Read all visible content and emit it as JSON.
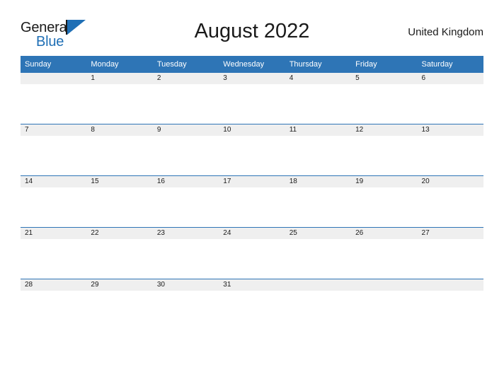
{
  "brand": {
    "name_top": "General",
    "name_bottom": "Blue",
    "flag_icon": "blue-flag-triangle",
    "accent_color": "#1f6fb5"
  },
  "header": {
    "title": "August 2022",
    "country": "United Kingdom"
  },
  "colors": {
    "header_blue": "#2e75b6",
    "row_band_gray": "#efefef",
    "text_dark": "#1a1a1a",
    "white": "#ffffff"
  },
  "calendar": {
    "month": "August",
    "year": "2022",
    "weekday_headers": [
      "Sunday",
      "Monday",
      "Tuesday",
      "Wednesday",
      "Thursday",
      "Friday",
      "Saturday"
    ],
    "weeks": [
      [
        "",
        "1",
        "2",
        "3",
        "4",
        "5",
        "6"
      ],
      [
        "7",
        "8",
        "9",
        "10",
        "11",
        "12",
        "13"
      ],
      [
        "14",
        "15",
        "16",
        "17",
        "18",
        "19",
        "20"
      ],
      [
        "21",
        "22",
        "23",
        "24",
        "25",
        "26",
        "27"
      ],
      [
        "28",
        "29",
        "30",
        "31",
        "",
        "",
        ""
      ]
    ]
  }
}
